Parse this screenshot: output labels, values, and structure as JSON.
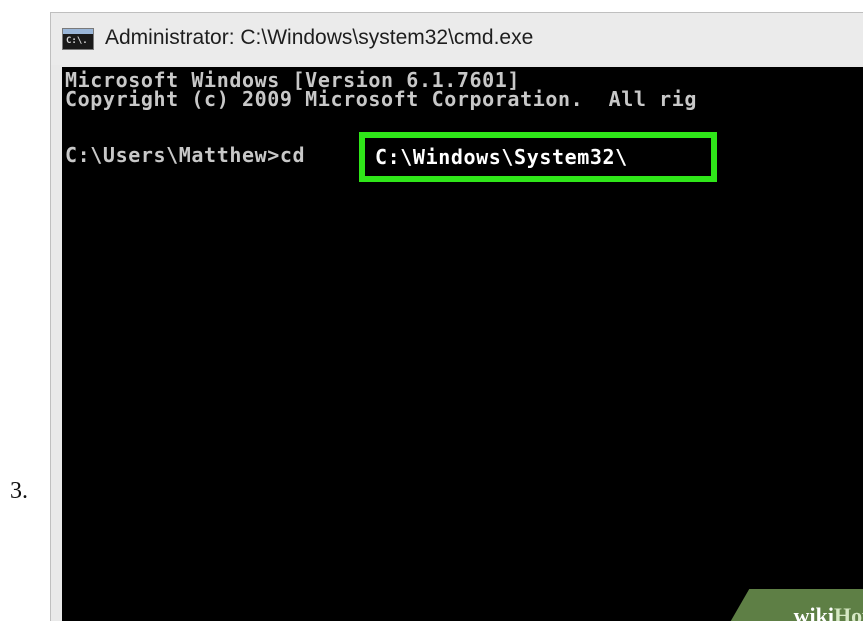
{
  "step": {
    "number": "3."
  },
  "window": {
    "title": "Administrator: C:\\Windows\\system32\\cmd.exe",
    "icon_name": "cmd-window-icon",
    "icon_label": "C:\\."
  },
  "console": {
    "lines": [
      "Microsoft Windows [Version 6.1.7601]",
      "Copyright (c) 2009 Microsoft Corporation.  All rig",
      "C:\\Users\\Matthew>cd"
    ],
    "highlighted_input": "C:\\Windows\\System32\\",
    "highlight_color": "#2fe619"
  },
  "watermark": {
    "part1": "wiki",
    "part2": "How",
    "color": "#5e7f45"
  }
}
